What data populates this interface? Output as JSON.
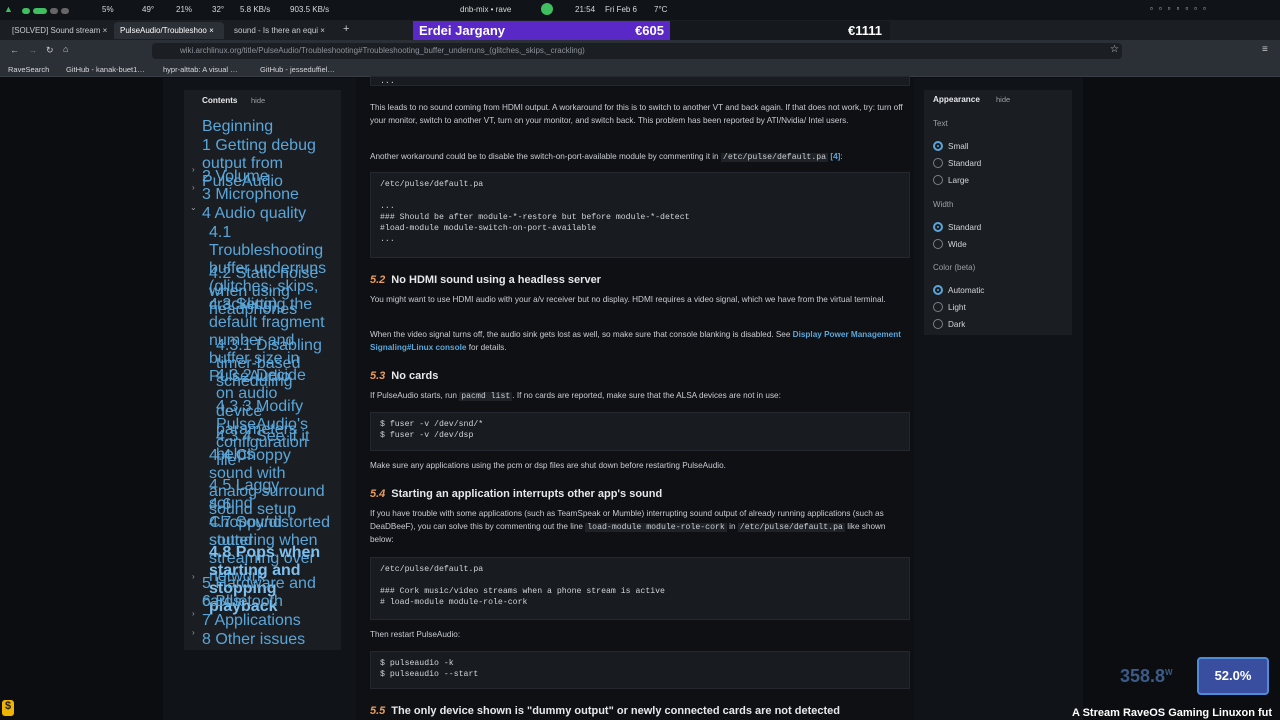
{
  "statusbar": {
    "cpu": "5%",
    "temp1": "49°",
    "ram": "21%",
    "temp2": "32°",
    "down": "5.8 KB/s",
    "up": "903.5 KB/s",
    "media": "dnb-mix • rave",
    "clock": "21:54",
    "date": "Fri Feb 6",
    "weather": "7°C"
  },
  "tabs": [
    {
      "label": "[SOLVED] Sound stream"
    },
    {
      "label": "PulseAudio/Troubleshoo"
    },
    {
      "label": "sound - Is there an equi"
    }
  ],
  "overlay": {
    "name": "Erdei Jargany",
    "amount": "€605",
    "total": "€1111"
  },
  "url": "wiki.archlinux.org/title/PulseAudio/Troubleshooting#Troubleshooting_buffer_underruns_(glitches,_skips,_crackling)",
  "bookmarks": [
    "RaveSearch",
    "GitHub - kanak-buet1…",
    "hypr-alttab: A visual …",
    "GitHub - jesseduffiel…"
  ],
  "toc": {
    "title": "Contents",
    "hide": "hide",
    "items": [
      "Beginning",
      "1 Getting debug output from PulseAudio",
      "2 Volume",
      "3 Microphone",
      "4 Audio quality",
      "4.1 Troubleshooting buffer underruns (glitches, skips, crackling)",
      "4.2 Static noise when using headphones",
      "4.3 Setting the default fragment number and buffer size in PulseAudio",
      "4.3.1 Disabling timer-based scheduling",
      "4.3.2 Decide on audio device parameters",
      "4.3.3 Modify PulseAudio's configuration file",
      "4.3.4 See if it helps",
      "4.4 Choppy sound with analog surround sound setup",
      "4.5 Laggy sound",
      "4.6 Choppy/distorted sound",
      "4.7 Sound stuttering when streaming over network",
      "4.8 Pops when starting and stopping playback",
      "5 Hardware and cards",
      "6 Bluetooth",
      "7 Applications",
      "8 Other issues"
    ]
  },
  "content": {
    "dots": "...",
    "p1": "This leads to no sound coming from HDMI output. A workaround for this is to switch to another VT and back again. If that does not work, try: turn off your monitor, switch to another VT, turn on your monitor, and switch back. This problem has been reported by ATI/Nvidia/ Intel users.",
    "p2a": "Another workaround could be to disable the switch-on-port-available module by commenting it in",
    "p2code": "/etc/pulse/default.pa",
    "p2ref": "[4]",
    "code1": "/etc/pulse/default.pa\n\n...\n### Should be after module-*-restore but before module-*-detect\n#load-module module-switch-on-port-available\n...",
    "h52num": "5.2",
    "h52": "No HDMI sound using a headless server",
    "p3": "You might want to use HDMI audio with your a/v receiver but no display. HDMI requires a video signal, which we have from the virtual terminal.",
    "p4a": "When the video signal turns off, the audio sink gets lost as well, so make sure that console blanking is disabled. See",
    "p4link": "Display Power Management Signaling#Linux console",
    "p4b": "for details.",
    "h53num": "5.3",
    "h53": "No cards",
    "p5a": "If PulseAudio starts, run",
    "p5code": "pacmd list",
    "p5b": ". If no cards are reported, make sure that the ALSA devices are not in use:",
    "code2": "$ fuser -v /dev/snd/*\n$ fuser -v /dev/dsp",
    "p6": "Make sure any applications using the pcm or dsp files are shut down before restarting PulseAudio.",
    "h54num": "5.4",
    "h54": "Starting an application interrupts other app's sound",
    "p7a": "If you have trouble with some applications (such as TeamSpeak or Mumble) interrupting sound output of already running applications (such as DeaDBeeF), you can solve this by commenting out the line",
    "p7code1": "load-module module-role-cork",
    "p7b": "in",
    "p7code2": "/etc/pulse/default.pa",
    "p7c": "like shown below:",
    "code3": "/etc/pulse/default.pa\n\n### Cork music/video streams when a phone stream is active\n# load-module module-role-cork",
    "p8": "Then restart PulseAudio:",
    "code4": "$ pulseaudio -k\n$ pulseaudio --start",
    "h55num": "5.5",
    "h55": "The only device shown is \"dummy output\" or newly connected cards are not detected"
  },
  "appearance": {
    "title": "Appearance",
    "hide": "hide",
    "text_label": "Text",
    "text_options": [
      "Small",
      "Standard",
      "Large"
    ],
    "width_label": "Width",
    "width_options": [
      "Standard",
      "Wide"
    ],
    "color_label": "Color (beta)",
    "color_options": [
      "Automatic",
      "Light",
      "Dark"
    ]
  },
  "stream": {
    "watts": "358.8",
    "watt_unit": "W",
    "percent": "52.0%",
    "ticker": "A Stream RaveOS Gaming Linuxon fut"
  },
  "colors": {
    "accent": "#5aa6d9",
    "overlay": "#5a28c6",
    "section_num": "#e89b5f"
  }
}
